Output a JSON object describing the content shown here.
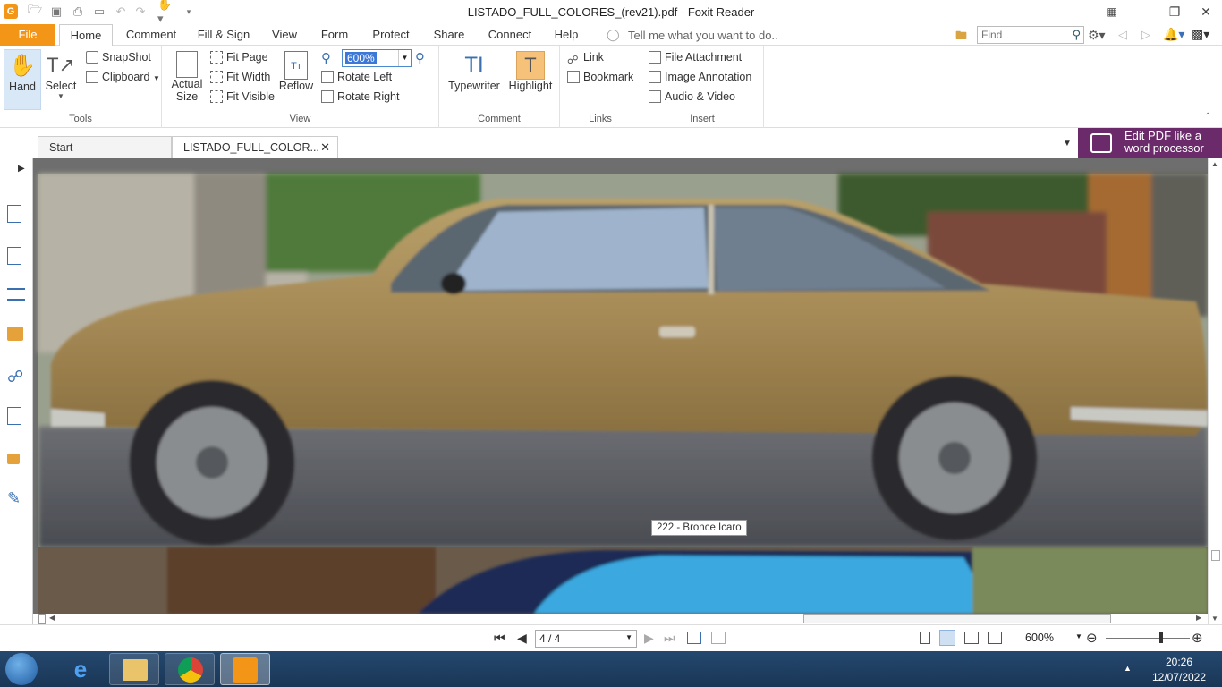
{
  "window": {
    "title": "LISTADO_FULL_COLORES_(rev21).pdf - Foxit Reader"
  },
  "menu": {
    "file": "File",
    "tabs": [
      "Home",
      "Comment",
      "Fill & Sign",
      "View",
      "Form",
      "Protect",
      "Share",
      "Connect",
      "Help"
    ],
    "tell_me": "Tell me what you want to do..",
    "find_placeholder": "Find"
  },
  "ribbon": {
    "tools": {
      "label": "Tools",
      "hand": "Hand",
      "select": "Select",
      "snapshot": "SnapShot",
      "clipboard": "Clipboard"
    },
    "view": {
      "label": "View",
      "actual_size_1": "Actual",
      "actual_size_2": "Size",
      "zoom_value": "600%",
      "fit_page": "Fit Page",
      "fit_width": "Fit Width",
      "fit_visible": "Fit Visible",
      "reflow": "Reflow",
      "rotate_left": "Rotate Left",
      "rotate_right": "Rotate Right"
    },
    "comment": {
      "label": "Comment",
      "typewriter": "Typewriter",
      "highlight": "Highlight"
    },
    "links": {
      "label": "Links",
      "link": "Link",
      "bookmark": "Bookmark"
    },
    "insert": {
      "label": "Insert",
      "file_attachment": "File Attachment",
      "image_annotation": "Image Annotation",
      "audio_video": "Audio & Video"
    }
  },
  "doc_tabs": {
    "start": "Start",
    "current": "LISTADO_FULL_COLOR..."
  },
  "promo": {
    "line1": "Edit PDF like a",
    "line2": "word processor"
  },
  "document": {
    "tooltip": "222 - Bronce Icaro"
  },
  "status": {
    "page": "4 / 4",
    "zoom": "600%"
  },
  "taskbar": {
    "time": "20:26",
    "date": "12/07/2022"
  },
  "colors": {
    "accent": "#f39517",
    "promo_bg": "#6b2b6b",
    "car": "#a68a56"
  }
}
